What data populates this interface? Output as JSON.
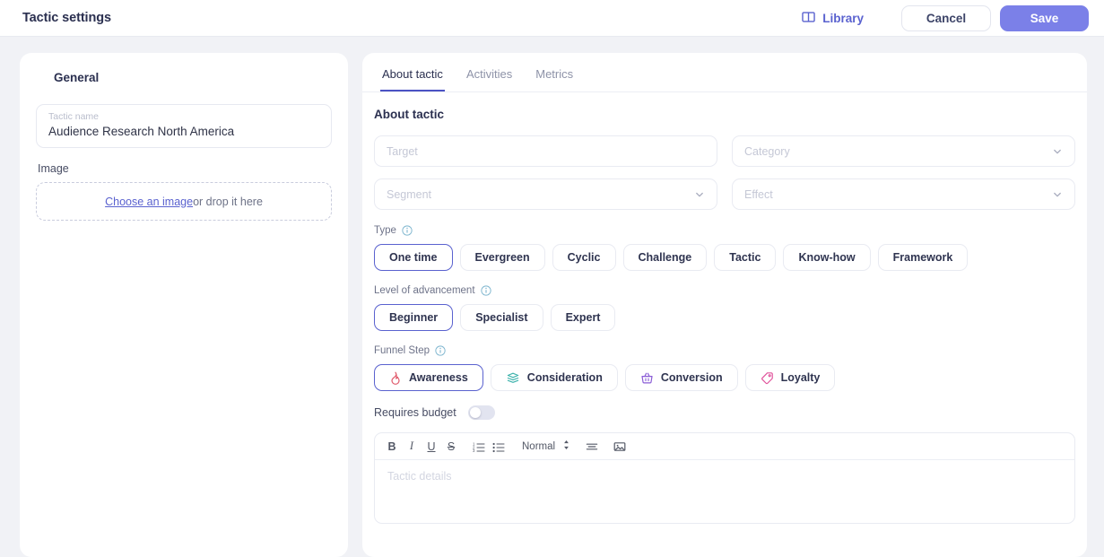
{
  "header": {
    "title": "Tactic settings",
    "library_label": "Library",
    "library_icon": "book-icon",
    "cancel_label": "Cancel",
    "save_label": "Save",
    "accent_color": "#7b80e8",
    "link_color": "#5a62cf"
  },
  "sidebar": {
    "section_title": "General",
    "tactic_name": {
      "label": "Tactic name",
      "value": "Audience Research North America"
    },
    "image": {
      "label": "Image",
      "choose_label": "Choose an image ",
      "drop_label": "or drop it here"
    }
  },
  "tabs": [
    {
      "label": "About tactic",
      "active": true
    },
    {
      "label": "Activities",
      "active": false
    },
    {
      "label": "Metrics",
      "active": false
    }
  ],
  "main": {
    "title": "About tactic",
    "fields": [
      {
        "name": "target",
        "placeholder": "Target",
        "value": "",
        "type": "text"
      },
      {
        "name": "category",
        "placeholder": "Category",
        "value": "",
        "type": "select"
      },
      {
        "name": "segment",
        "placeholder": "Segment",
        "value": "",
        "type": "select"
      },
      {
        "name": "effect",
        "placeholder": "Effect",
        "value": "",
        "type": "select"
      }
    ],
    "type_group": {
      "label": "Type",
      "info_icon": "info-icon",
      "options": [
        "One time",
        "Evergreen",
        "Cyclic",
        "Challenge",
        "Tactic",
        "Know-how",
        "Framework"
      ],
      "selected": "One time"
    },
    "level_group": {
      "label": "Level of advancement",
      "info_icon": "info-icon",
      "options": [
        "Beginner",
        "Specialist",
        "Expert"
      ],
      "selected": "Beginner"
    },
    "funnel_group": {
      "label": "Funnel Step",
      "info_icon": "info-icon",
      "options": [
        {
          "label": "Awareness",
          "icon": "flame-icon",
          "color": "#e05a6b"
        },
        {
          "label": "Consideration",
          "icon": "layers-icon",
          "color": "#3fb3ad"
        },
        {
          "label": "Conversion",
          "icon": "basket-icon",
          "color": "#8a5cd6"
        },
        {
          "label": "Loyalty",
          "icon": "tag-icon",
          "color": "#e0529b"
        }
      ],
      "selected": "Awareness"
    },
    "requires_budget": {
      "label": "Requires budget",
      "enabled": false
    },
    "editor": {
      "placeholder": "Tactic details",
      "tools": [
        {
          "name": "bold",
          "label": "B"
        },
        {
          "name": "italic",
          "label": "I"
        },
        {
          "name": "underline",
          "label": "U"
        },
        {
          "name": "strikethrough",
          "label": "S"
        },
        {
          "name": "ordered-list",
          "label": ""
        },
        {
          "name": "bullet-list",
          "label": ""
        },
        {
          "name": "format",
          "label": "Normal"
        },
        {
          "name": "align",
          "label": ""
        },
        {
          "name": "image",
          "label": ""
        }
      ],
      "format_value": "Normal"
    }
  }
}
